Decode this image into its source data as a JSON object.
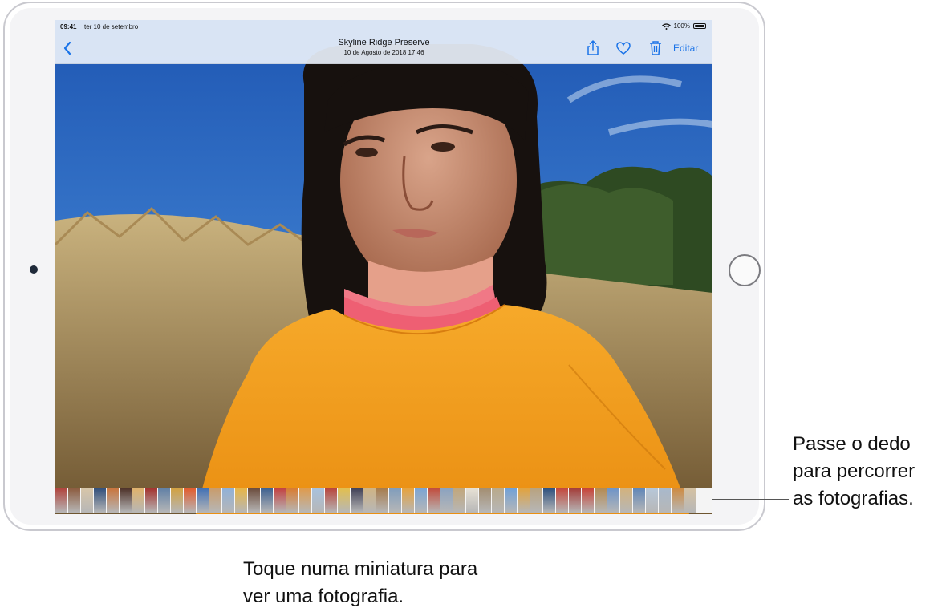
{
  "status_bar": {
    "time": "09:41",
    "date": "ter 10 de setembro",
    "battery": "100%",
    "battery_level": 1.0
  },
  "nav": {
    "title": "Skyline Ridge Preserve",
    "subtitle": "10 de Agosto de 2018 17:46",
    "edit_label": "Editar",
    "icons": [
      "chevron-left-icon",
      "share-icon",
      "heart-icon",
      "trash-icon"
    ],
    "accent_color": "#1a73e8"
  },
  "filmstrip": {
    "thumbnails": [
      "#b0413a",
      "#8b5a3c",
      "#d8c6a8",
      "#2e4d7a",
      "#c9733a",
      "#4b2e25",
      "#e1b26a",
      "#a32f2b",
      "#5f7fa5",
      "#d2a03e",
      "#e35a2a",
      "#3f6fb5",
      "#c99b6a",
      "#8fb0d8",
      "#e8b545",
      "#6a4a3a",
      "#3b5f8f",
      "#c33f3f",
      "#d97a2e",
      "#e09a4a",
      "#a8c2de",
      "#b8433a",
      "#e3bf4c",
      "#3f3f55",
      "#d0b383",
      "#a67a4a",
      "#7f9cbc",
      "#e8a23a",
      "#7aa4d4",
      "#c24a3a",
      "#8aa2c0",
      "#c2a67a",
      "#e8e2d6",
      "#a38d70",
      "#b9a98a",
      "#6fa0d8",
      "#e3a23a",
      "#b8a27e",
      "#2b4f7d",
      "#c4453a",
      "#a33a36",
      "#c84034",
      "#b4894f",
      "#6c93c8",
      "#d3b27c",
      "#5e85b8",
      "#b7c8da",
      "#a8b9cc",
      "#cf8a3e",
      "#d6c2a2"
    ]
  },
  "callouts": {
    "right": [
      "Passe o dedo",
      "para percorrer",
      "as fotografias."
    ],
    "bottom": [
      "Toque numa miniatura para",
      "ver uma fotografia."
    ]
  }
}
